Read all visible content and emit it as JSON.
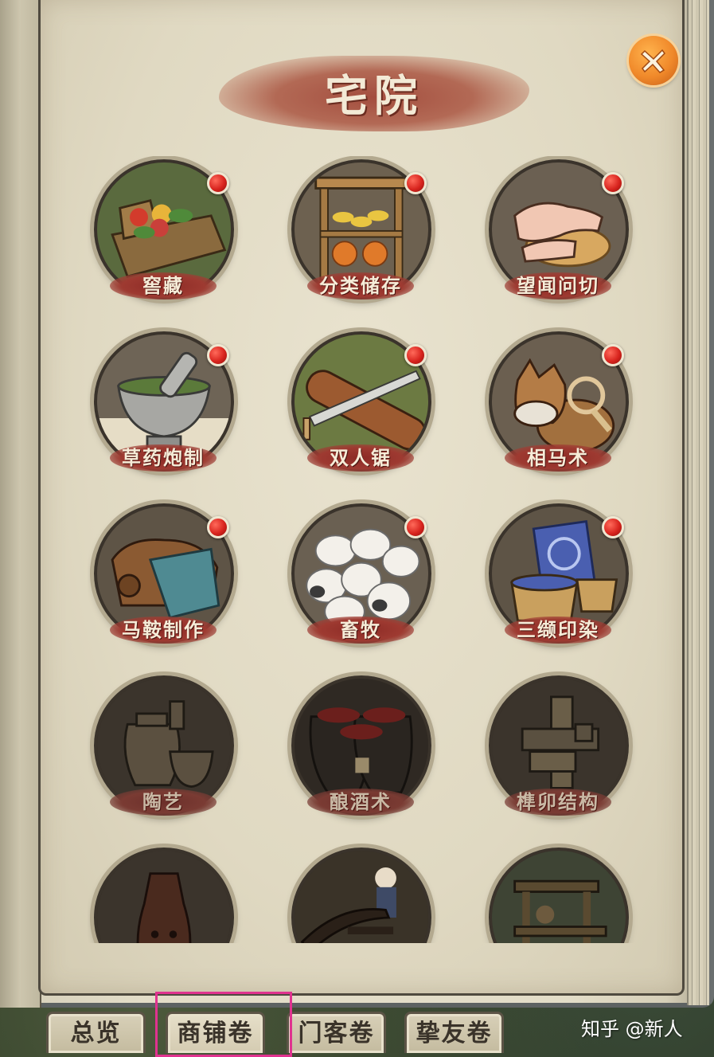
{
  "title": "宅院",
  "close_icon": "close-x-icon",
  "skills": [
    {
      "name": "窖藏",
      "icon": "cellar-icon",
      "badge": true,
      "locked": false
    },
    {
      "name": "分类储存",
      "icon": "storage-shelf-icon",
      "badge": true,
      "locked": false
    },
    {
      "name": "望闻问切",
      "icon": "pulse-diagnosis-icon",
      "badge": true,
      "locked": false
    },
    {
      "name": "草药炮制",
      "icon": "mortar-icon",
      "badge": true,
      "locked": false
    },
    {
      "name": "双人锯",
      "icon": "saw-icon",
      "badge": true,
      "locked": false
    },
    {
      "name": "相马术",
      "icon": "horse-icon",
      "badge": true,
      "locked": false
    },
    {
      "name": "马鞍制作",
      "icon": "saddle-icon",
      "badge": true,
      "locked": false
    },
    {
      "name": "畜牧",
      "icon": "sheep-icon",
      "badge": true,
      "locked": false
    },
    {
      "name": "三缬印染",
      "icon": "dyeing-icon",
      "badge": true,
      "locked": false
    },
    {
      "name": "陶艺",
      "icon": "pottery-icon",
      "badge": false,
      "locked": true
    },
    {
      "name": "酿酒术",
      "icon": "wine-jar-icon",
      "badge": false,
      "locked": true
    },
    {
      "name": "榫卯结构",
      "icon": "mortise-tenon-icon",
      "badge": false,
      "locked": true
    },
    {
      "name": "",
      "icon": "ocarina-icon",
      "badge": false,
      "locked": true
    },
    {
      "name": "",
      "icon": "plow-icon",
      "badge": false,
      "locked": true
    },
    {
      "name": "",
      "icon": "loom-icon",
      "badge": false,
      "locked": true
    }
  ],
  "tabs": [
    {
      "label": "总览"
    },
    {
      "label": "商铺卷"
    },
    {
      "label": "门客卷"
    },
    {
      "label": "挚友卷"
    }
  ],
  "active_tab": "商铺卷",
  "watermark": "知乎 @新人",
  "colors": {
    "badge": "#d8241e",
    "label_ribbon": "#8c2a25",
    "close_button": "#f0892a",
    "highlight_box": "#e0338f"
  }
}
